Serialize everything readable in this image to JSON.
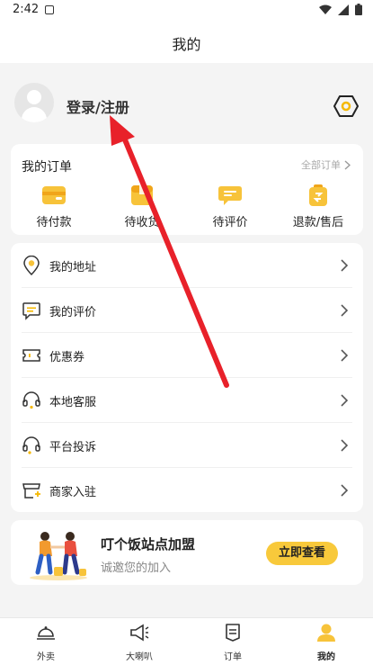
{
  "status_bar": {
    "time": "2:42"
  },
  "header": {
    "title": "我的"
  },
  "profile": {
    "login_label": "登录/注册"
  },
  "orders": {
    "title": "我的订单",
    "view_all": "全部订单",
    "items": [
      {
        "label": "待付款",
        "icon": "wallet-icon"
      },
      {
        "label": "待收货",
        "icon": "package-icon"
      },
      {
        "label": "待评价",
        "icon": "comment-icon"
      },
      {
        "label": "退款/售后",
        "icon": "refund-icon"
      }
    ]
  },
  "menu": {
    "items": [
      {
        "label": "我的地址",
        "icon": "location-icon"
      },
      {
        "label": "我的评价",
        "icon": "review-icon"
      },
      {
        "label": "优惠券",
        "icon": "coupon-icon"
      },
      {
        "label": "本地客服",
        "icon": "headset-icon"
      },
      {
        "label": "平台投诉",
        "icon": "complaint-headset-icon"
      },
      {
        "label": "商家入驻",
        "icon": "store-icon"
      }
    ]
  },
  "banner": {
    "title": "叮个饭站点加盟",
    "subtitle": "诚邀您的加入",
    "button": "立即查看"
  },
  "tabbar": {
    "tabs": [
      {
        "label": "外卖",
        "icon": "cloche-icon"
      },
      {
        "label": "大喇叭",
        "icon": "megaphone-icon"
      },
      {
        "label": "订单",
        "icon": "order-icon"
      },
      {
        "label": "我的",
        "icon": "user-icon",
        "active": true
      }
    ]
  },
  "colors": {
    "accent": "#f8c93b",
    "annotation_arrow": "#e8212a"
  }
}
